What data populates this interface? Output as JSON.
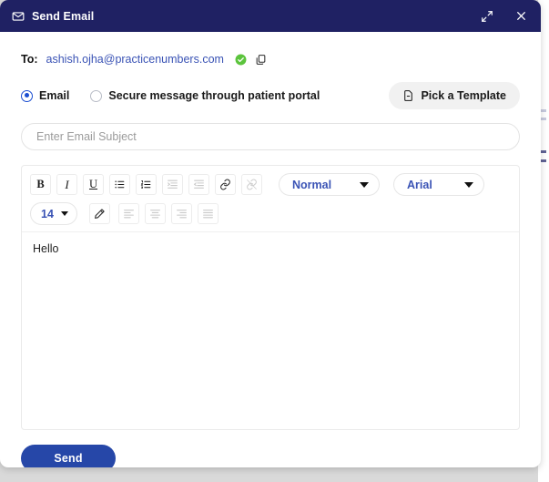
{
  "window": {
    "title": "Send Email",
    "title_icon": "envelope-icon",
    "expand_icon": "expand-arrows-icon",
    "close_icon": "close-icon",
    "header_color": "#1f2163"
  },
  "recipient": {
    "label": "To:",
    "email": "ashish.ojha@practicenumbers.com",
    "email_color": "#3a53b5",
    "verified_icon": "verified-check-icon",
    "verified_color": "#5cc43d",
    "copy_icon": "copy-icon"
  },
  "delivery_options": {
    "items": [
      {
        "label": "Email",
        "selected": true
      },
      {
        "label": "Secure message through patient portal",
        "selected": false
      }
    ],
    "selected_color": "#1b4ed1"
  },
  "template_button": {
    "label": "Pick a Template",
    "icon": "document-icon"
  },
  "subject": {
    "value": "",
    "placeholder": "Enter Email Subject"
  },
  "toolbar": {
    "row1": [
      {
        "name": "bold-button",
        "label": "B",
        "enabled": true
      },
      {
        "name": "italic-button",
        "label": "I",
        "enabled": true
      },
      {
        "name": "underline-button",
        "label": "U",
        "enabled": true
      },
      {
        "name": "bulleted-list-button",
        "label": "",
        "enabled": true
      },
      {
        "name": "numbered-list-button",
        "label": "",
        "enabled": true
      },
      {
        "name": "indent-button",
        "label": "",
        "enabled": false
      },
      {
        "name": "outdent-button",
        "label": "",
        "enabled": false
      },
      {
        "name": "link-button",
        "label": "",
        "enabled": true
      },
      {
        "name": "unlink-button",
        "label": "",
        "enabled": false
      }
    ],
    "heading_select": {
      "value": "Normal"
    },
    "font_select": {
      "value": "Arial"
    },
    "size_select": {
      "value": "14"
    },
    "row2": [
      {
        "name": "text-color-button",
        "label": "",
        "enabled": true
      },
      {
        "name": "align-left-button",
        "label": "",
        "enabled": false
      },
      {
        "name": "align-center-button",
        "label": "",
        "enabled": false
      },
      {
        "name": "align-right-button",
        "label": "",
        "enabled": false
      },
      {
        "name": "align-justify-button",
        "label": "",
        "enabled": false
      }
    ]
  },
  "body": {
    "text": "Hello"
  },
  "send_button": {
    "label": "Send",
    "color": "#2647a8"
  }
}
